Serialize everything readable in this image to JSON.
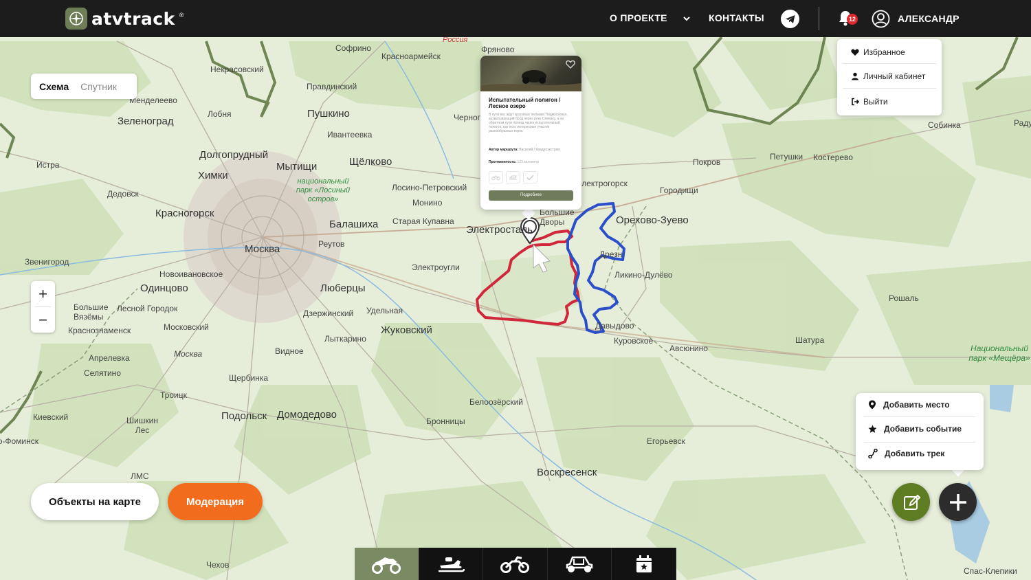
{
  "header": {
    "logo_text": "atvtrack",
    "logo_mark": "®",
    "nav": [
      {
        "label": "О ПРОЕКТЕ"
      },
      {
        "label": "КОНТАКТЫ"
      }
    ],
    "notifications_count": "12",
    "user_name": "АЛЕКСАНДР"
  },
  "user_menu": {
    "items": [
      {
        "label": "Избранное",
        "icon": "heart-icon"
      },
      {
        "label": "Личный кабинет",
        "icon": "person-icon"
      },
      {
        "label": "Выйти",
        "icon": "logout-icon"
      }
    ]
  },
  "layer_switch": {
    "scheme": "Схема",
    "satellite": "Спутник"
  },
  "zoom": {
    "plus": "+",
    "minus": "−"
  },
  "popup": {
    "title": "Испытательный полигон / Лесное озеро",
    "description": "В пути вас ждут красивые пейзажи Подмосковья, захватывающий брод через реку Северку, а на обратном пути проезд через испытательный полигон, где есть интересные участки разнообразных горок.",
    "author_label": "Автор маршрута:",
    "author_value": "Василий / Квадроэкстрим",
    "length_label": "Протяженность:",
    "length_value": "123 километр",
    "button": "Подробнее"
  },
  "add_menu": {
    "items": [
      {
        "label": "Добавить место",
        "icon": "pin-icon"
      },
      {
        "label": "Добавить событие",
        "icon": "star-icon"
      },
      {
        "label": "Добавить трек",
        "icon": "track-icon"
      }
    ]
  },
  "buttons": {
    "objects": "Объекты на карте",
    "moderation": "Модерация"
  },
  "bottom_bar": {
    "items": [
      {
        "icon": "atv-icon",
        "active": true
      },
      {
        "icon": "snowmobile-icon",
        "active": false
      },
      {
        "icon": "motorcycle-icon",
        "active": false
      },
      {
        "icon": "buggy-icon",
        "active": false
      },
      {
        "icon": "calendar-star-icon",
        "active": false
      }
    ]
  },
  "map": {
    "towns": [
      {
        "name": "Москва",
        "big": true
      },
      {
        "name": "Зеленоград",
        "big": true
      },
      {
        "name": "Пушкино",
        "big": true
      },
      {
        "name": "Мытищи",
        "big": true
      },
      {
        "name": "Щёлково",
        "big": true
      },
      {
        "name": "Химки",
        "big": true
      },
      {
        "name": "Долгопрудный",
        "big": true
      },
      {
        "name": "Красногорск",
        "big": true
      },
      {
        "name": "Балашиха",
        "big": true
      },
      {
        "name": "Одинцово",
        "big": true
      },
      {
        "name": "Люберцы",
        "big": true
      },
      {
        "name": "Электросталь",
        "big": true
      },
      {
        "name": "Большие Дворы",
        "big": true
      },
      {
        "name": "Орехово-Зуево",
        "big": true
      },
      {
        "name": "Жуковский",
        "big": true
      },
      {
        "name": "Подольск",
        "big": true
      },
      {
        "name": "Домодедово",
        "big": true
      },
      {
        "name": "Воскресенск",
        "big": true
      },
      {
        "name": "Правдинский",
        "big": false
      },
      {
        "name": "Ивантеевка",
        "big": false
      },
      {
        "name": "Истра",
        "big": false
      },
      {
        "name": "Дедовск",
        "big": false
      },
      {
        "name": "Софрино",
        "big": false
      },
      {
        "name": "Красноармейск",
        "big": false
      },
      {
        "name": "Фряново",
        "big": false
      },
      {
        "name": "Менделеево",
        "big": false
      },
      {
        "name": "Лобня",
        "big": false
      },
      {
        "name": "Некрасовский",
        "big": false
      },
      {
        "name": "Лосино-Петровский",
        "big": false
      },
      {
        "name": "Монино",
        "big": false
      },
      {
        "name": "Старая Купавна",
        "big": false
      },
      {
        "name": "Реутов",
        "big": false
      },
      {
        "name": "Электроугли",
        "big": false
      },
      {
        "name": "Звенигород",
        "big": false
      },
      {
        "name": "Новоивановское",
        "big": false
      },
      {
        "name": "Большие Вязёмы",
        "big": false
      },
      {
        "name": "Лесной Городок",
        "big": false
      },
      {
        "name": "Краснознаменск",
        "big": false
      },
      {
        "name": "Московский",
        "big": false
      },
      {
        "name": "Дзержинский",
        "big": false
      },
      {
        "name": "Удельная",
        "big": false
      },
      {
        "name": "Лыткарино",
        "big": false
      },
      {
        "name": "Видное",
        "big": false
      },
      {
        "name": "Апрелевка",
        "big": false
      },
      {
        "name": "Селятино",
        "big": false
      },
      {
        "name": "Щербинка",
        "big": false
      },
      {
        "name": "Троицк",
        "big": false
      },
      {
        "name": "Киевский",
        "big": false
      },
      {
        "name": "Шишкин Лес",
        "big": false
      },
      {
        "name": "Белоозёрский",
        "big": false
      },
      {
        "name": "Бронницы",
        "big": false
      },
      {
        "name": "Егорьевск",
        "big": false
      },
      {
        "name": "Покров",
        "big": false
      },
      {
        "name": "Петушки",
        "big": false
      },
      {
        "name": "Костерево",
        "big": false
      },
      {
        "name": "Собинка",
        "big": false
      },
      {
        "name": "Городищи",
        "big": false
      },
      {
        "name": "Электрогорск",
        "big": false
      },
      {
        "name": "Ликино-Дулёво",
        "big": false
      },
      {
        "name": "Давыдово",
        "big": false
      },
      {
        "name": "Куровское",
        "big": false
      },
      {
        "name": "Авсюнино",
        "big": false
      },
      {
        "name": "Шатура",
        "big": false
      },
      {
        "name": "Рошаль",
        "big": false
      },
      {
        "name": "Черноголовка",
        "big": false
      },
      {
        "name": "Дрезна",
        "big": false
      },
      {
        "name": "Спас-Клепики",
        "big": false
      },
      {
        "name": "ЛМС",
        "big": false
      },
      {
        "name": "Чехов",
        "big": false
      },
      {
        "name": "Наро-Фоминск",
        "big": false
      },
      {
        "name": "Радужный",
        "big": false
      },
      {
        "name": "Москва",
        "big": false,
        "italic": true
      },
      {
        "name": "Россия",
        "big": false,
        "red": true
      },
      {
        "name": "национальный парк «Лосиный остров»",
        "park": true
      },
      {
        "name": "Национальный парк «Мещёра»",
        "park": true
      }
    ]
  },
  "colors": {
    "header_bg": "#1c1c1c",
    "accent_orange": "#f26c1e",
    "accent_green": "#5e7c22",
    "olive": "#7a8a63",
    "route_red": "#d0273b",
    "route_blue": "#2a4fc9"
  }
}
